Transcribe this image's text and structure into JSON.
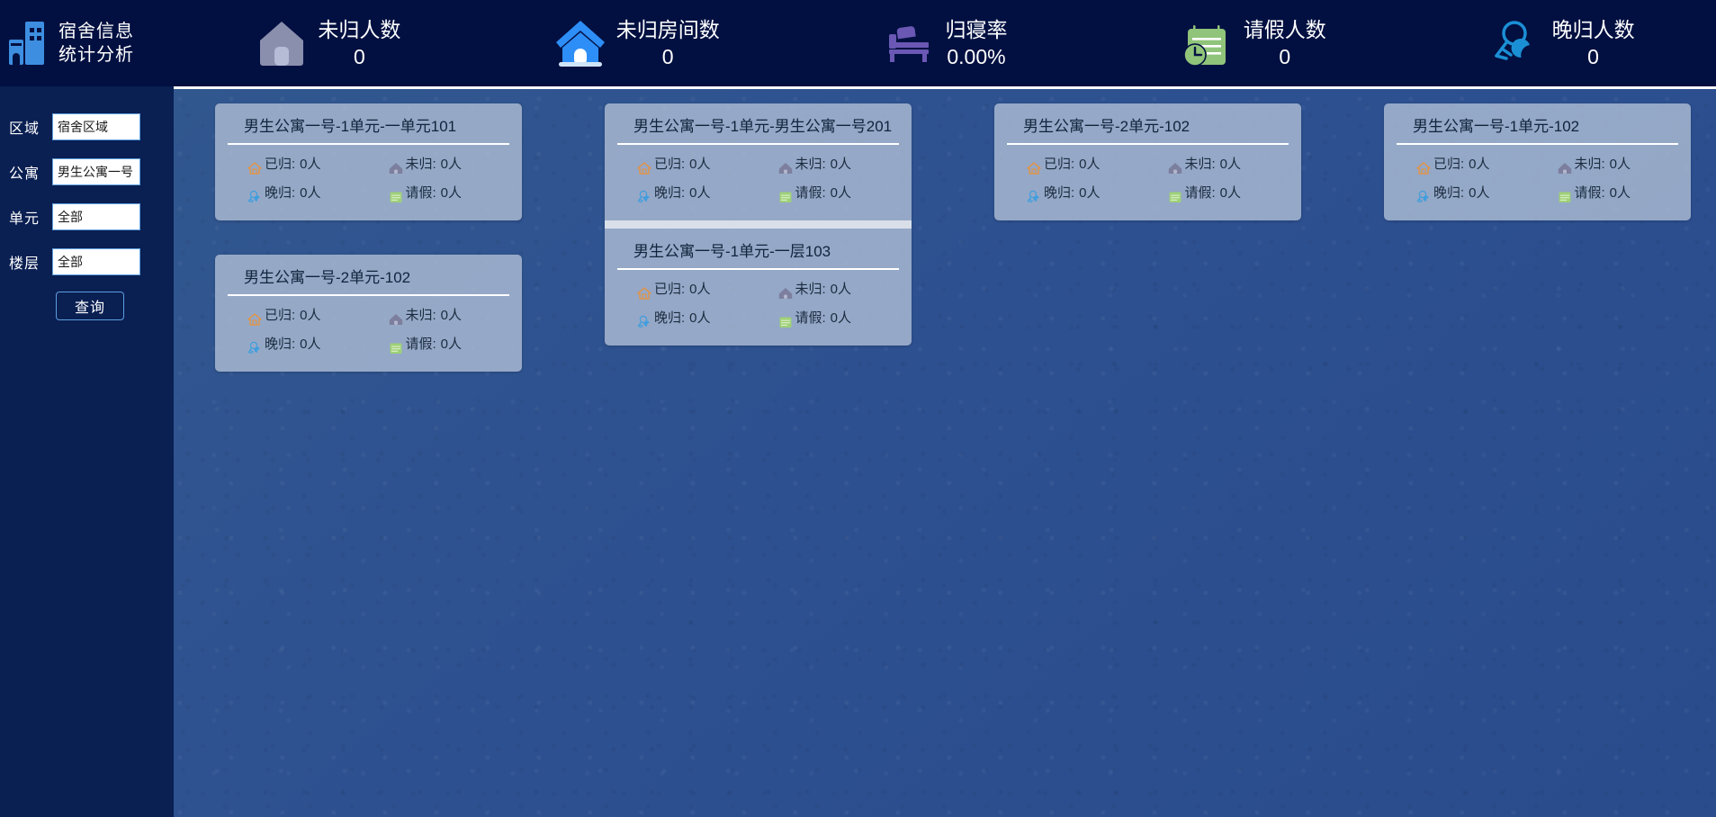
{
  "brand": {
    "line1": "宿舍信息",
    "line2": "统计分析",
    "icon": "building-icon"
  },
  "header": {
    "stats": [
      {
        "label": "未归人数",
        "value": "0",
        "icon": "house-gray-icon",
        "color": "#8b8fae"
      },
      {
        "label": "未归房间数",
        "value": "0",
        "icon": "house-blue-icon",
        "color": "#2e8ef7"
      },
      {
        "label": "归寝率",
        "value": "0.00%",
        "icon": "bed-icon",
        "color": "#6a58b4"
      },
      {
        "label": "请假人数",
        "value": "0",
        "icon": "calendar-clock-icon",
        "color": "#8fc47a"
      },
      {
        "label": "晚归人数",
        "value": "0",
        "icon": "person-moon-icon",
        "color": "#1b8fd6"
      }
    ]
  },
  "sidebar": {
    "fields": [
      {
        "label": "区域",
        "value": "宿舍区域",
        "name": "area-select"
      },
      {
        "label": "公寓",
        "value": "男生公寓一号",
        "name": "apartment-select"
      },
      {
        "label": "单元",
        "value": "全部",
        "name": "unit-select"
      },
      {
        "label": "楼层",
        "value": "全部",
        "name": "floor-select"
      }
    ],
    "query_label": "查询"
  },
  "card_labels": {
    "returned": "已归:",
    "not_returned": "未归:",
    "late": "晚归:",
    "leave": "请假:"
  },
  "columns": [
    {
      "panels": [
        {
          "cards": [
            {
              "title": "男生公寓一号-1单元-一单元101",
              "returned": "0人",
              "not_returned": "0人",
              "late": "0人",
              "leave": "0人"
            }
          ]
        },
        {
          "cards": [
            {
              "title": "男生公寓一号-2单元-102",
              "returned": "0人",
              "not_returned": "0人",
              "late": "0人",
              "leave": "0人"
            }
          ]
        }
      ]
    },
    {
      "panels": [
        {
          "cards": [
            {
              "title": "男生公寓一号-1单元-男生公寓一号201",
              "returned": "0人",
              "not_returned": "0人",
              "late": "0人",
              "leave": "0人"
            },
            {
              "title": "男生公寓一号-1单元-一层103",
              "returned": "0人",
              "not_returned": "0人",
              "late": "0人",
              "leave": "0人"
            }
          ]
        }
      ]
    },
    {
      "panels": [
        {
          "cards": [
            {
              "title": "男生公寓一号-2单元-102",
              "returned": "0人",
              "not_returned": "0人",
              "late": "0人",
              "leave": "0人"
            }
          ]
        }
      ]
    },
    {
      "panels": [
        {
          "cards": [
            {
              "title": "男生公寓一号-1单元-102",
              "returned": "0人",
              "not_returned": "0人",
              "late": "0人",
              "leave": "0人"
            }
          ]
        }
      ]
    }
  ]
}
